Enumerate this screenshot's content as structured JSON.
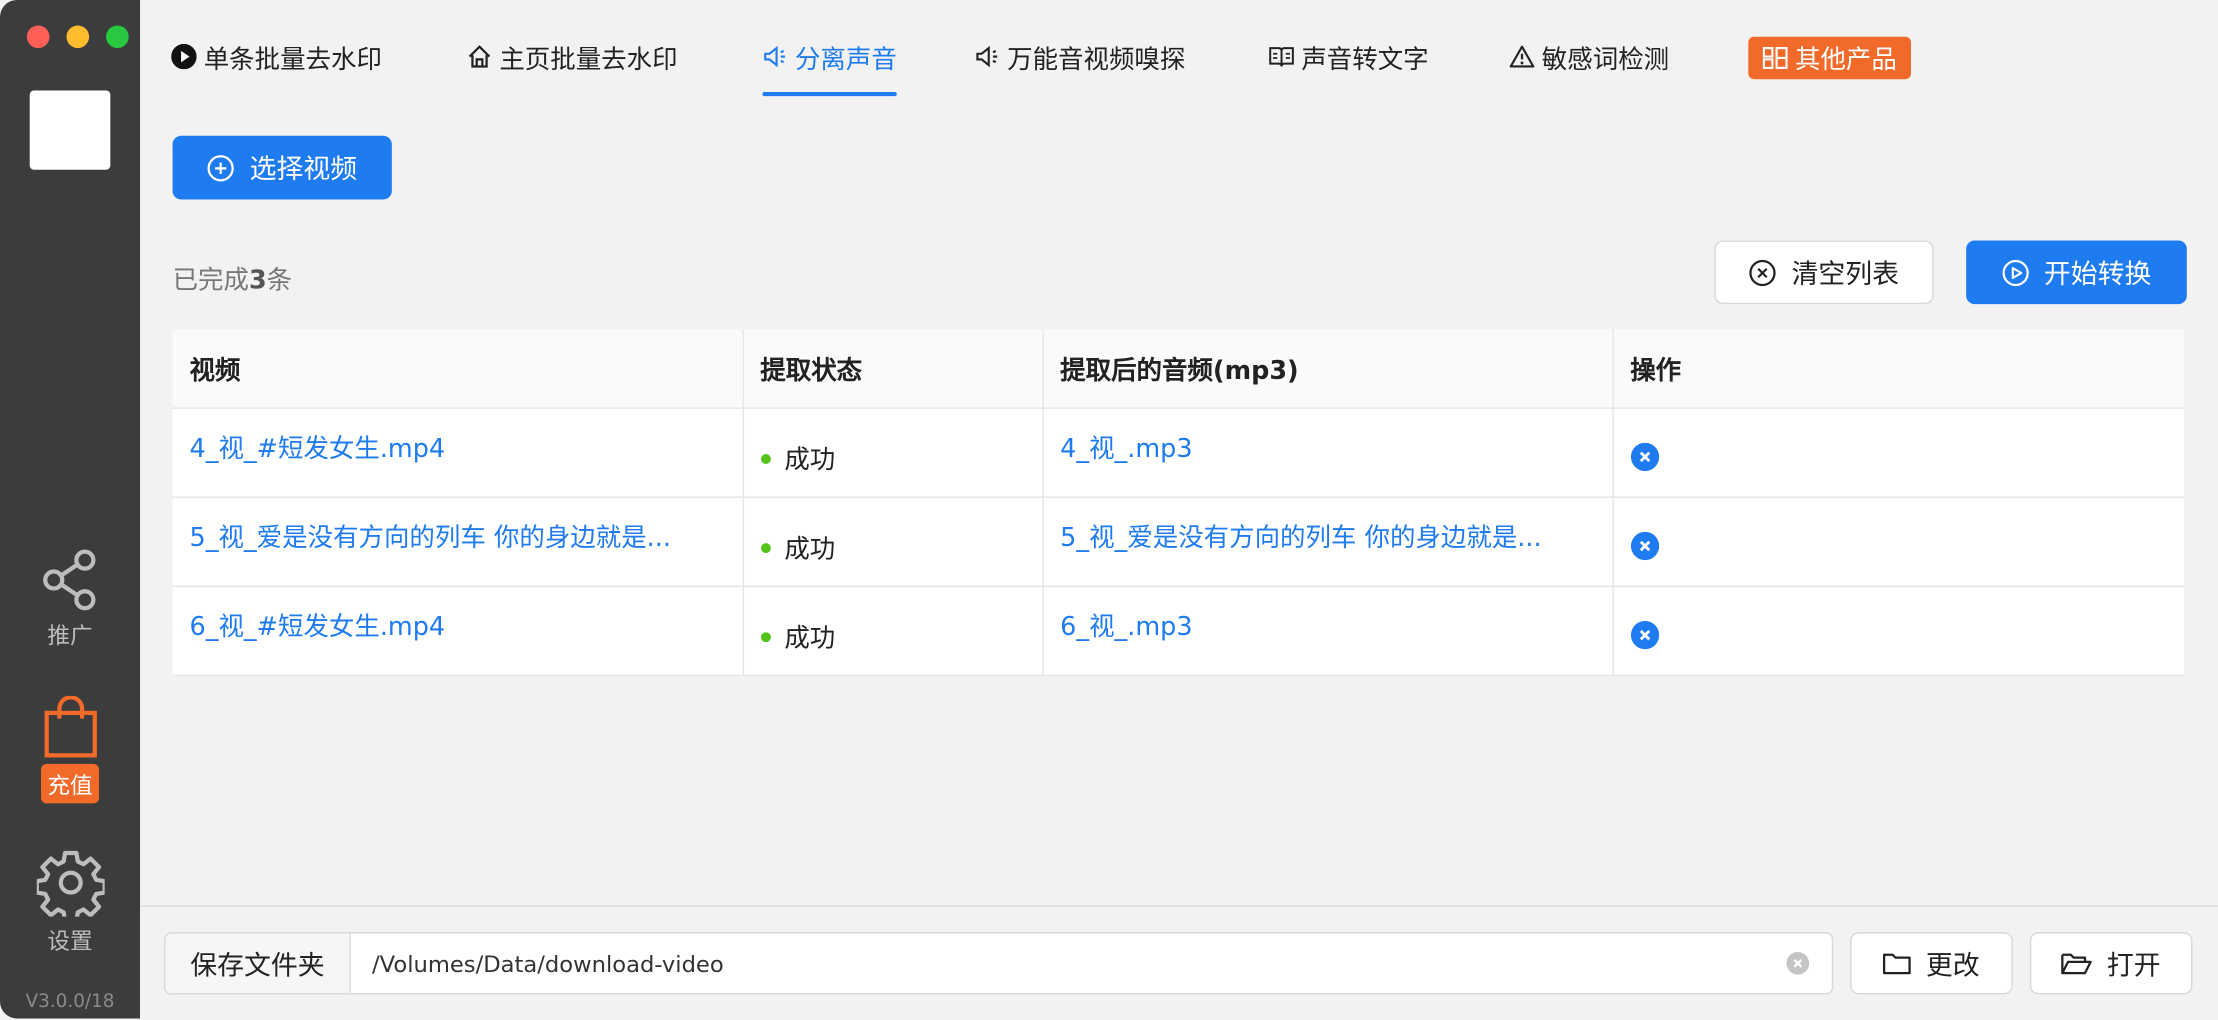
{
  "sidebar": {
    "share_label": "推广",
    "recharge_label": "充值",
    "settings_label": "设置",
    "version": "V3.0.0/18"
  },
  "tabs": [
    {
      "label": "单条批量去水印",
      "icon": "play-circle-icon"
    },
    {
      "label": "主页批量去水印",
      "icon": "home-icon"
    },
    {
      "label": "分离声音",
      "icon": "speaker-icon",
      "active": true
    },
    {
      "label": "万能音视频嗅探",
      "icon": "speaker-icon"
    },
    {
      "label": "声音转文字",
      "icon": "book-icon"
    },
    {
      "label": "敏感词检测",
      "icon": "warning-icon"
    },
    {
      "label": "其他产品",
      "icon": "grid-icon"
    }
  ],
  "actions": {
    "select_video": "选择视频",
    "clear_list": "清空列表",
    "start_convert": "开始转换"
  },
  "summary": {
    "prefix": "已完成",
    "count": "3",
    "suffix": "条"
  },
  "table": {
    "headers": [
      "视频",
      "提取状态",
      "提取后的音频(mp3)",
      "操作"
    ],
    "rows": [
      {
        "video": "4_视_#短发女生.mp4",
        "status": "成功",
        "audio": "4_视_.mp3"
      },
      {
        "video": "5_视_爱是没有方向的列车 你的身边就是...",
        "status": "成功",
        "audio": "5_视_爱是没有方向的列车 你的身边就是..."
      },
      {
        "video": "6_视_#短发女生.mp4",
        "status": "成功",
        "audio": "6_视_.mp3"
      }
    ]
  },
  "footer": {
    "save_label": "保存文件夹",
    "path": "/Volumes/Data/download-video",
    "change_label": "更改",
    "open_label": "打开"
  },
  "colors": {
    "accent": "#1e7bf0",
    "orange": "#f26a2a",
    "success": "#52c41a",
    "sidebar": "#3c3c3c"
  }
}
